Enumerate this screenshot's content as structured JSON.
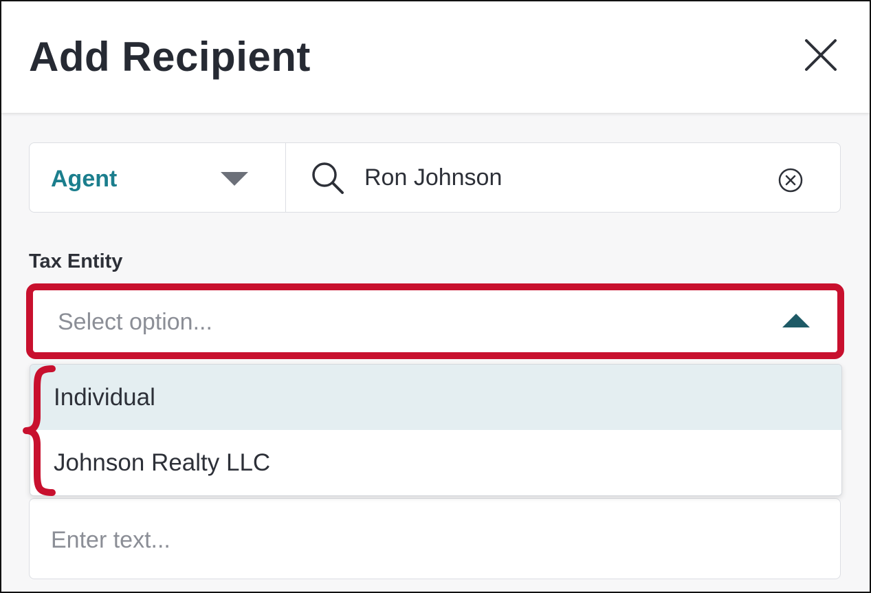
{
  "dialog": {
    "title": "Add Recipient",
    "close_icon": "close-icon"
  },
  "recipient_search": {
    "type_value": "Agent",
    "type_caret_icon": "caret-down-icon",
    "search_icon": "search-icon",
    "search_value": "Ron Johnson",
    "clear_icon": "clear-circle-icon"
  },
  "tax_entity": {
    "label": "Tax Entity",
    "placeholder": "Select option...",
    "caret_icon": "caret-up-icon",
    "expanded": true,
    "options": [
      {
        "label": "Individual",
        "hovered": true
      },
      {
        "label": "Johnson Realty LLC",
        "hovered": false
      }
    ]
  },
  "next_field": {
    "placeholder": "Enter text..."
  },
  "annotation": {
    "highlight_color": "#c8102e"
  },
  "colors": {
    "accent": "#1b7e8d",
    "caret_up": "#1e5a66",
    "hover_row": "#e4eef1",
    "title_text": "#262a33"
  }
}
